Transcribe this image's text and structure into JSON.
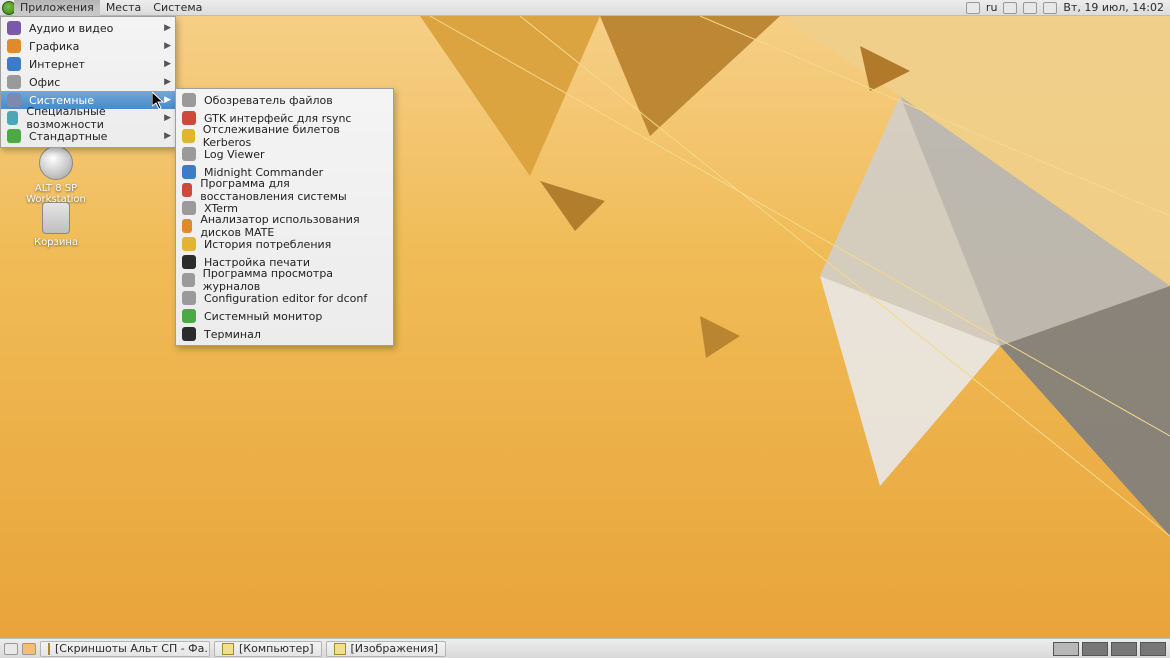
{
  "panel": {
    "menus": {
      "applications": "Приложения",
      "places": "Места",
      "system": "Система"
    },
    "tray": {
      "kb_layout": "ru",
      "clock": "Вт, 19 июл, 14:02"
    }
  },
  "desktop": {
    "icon1_line1": "ALT 8 SP",
    "icon1_line2": "Workstation",
    "trash_label": "Корзина"
  },
  "app_menu": {
    "items": [
      {
        "label": "Аудио и видео",
        "has_sub": true
      },
      {
        "label": "Графика",
        "has_sub": true
      },
      {
        "label": "Интернет",
        "has_sub": true
      },
      {
        "label": "Офис",
        "has_sub": true
      },
      {
        "label": "Системные",
        "has_sub": true,
        "selected": true
      },
      {
        "label": "Специальные возможности",
        "has_sub": true
      },
      {
        "label": "Стандартные",
        "has_sub": true
      }
    ]
  },
  "sub_menu": {
    "items": [
      {
        "label": "Обозреватель файлов"
      },
      {
        "label": "GTK интерфейс для rsync"
      },
      {
        "label": "Отслеживание билетов Kerberos"
      },
      {
        "label": "Log Viewer"
      },
      {
        "label": "Midnight Commander"
      },
      {
        "label": "Программа для восстановления системы"
      },
      {
        "label": "XTerm"
      },
      {
        "label": "Анализатор использования дисков MATE"
      },
      {
        "label": "История потребления"
      },
      {
        "label": "Настройка печати"
      },
      {
        "label": "Программа просмотра журналов"
      },
      {
        "label": "Configuration editor for dconf"
      },
      {
        "label": "Системный монитор"
      },
      {
        "label": "Терминал"
      }
    ]
  },
  "taskbar": {
    "tasks": [
      {
        "label": "[Скриншоты Альт СП - Фа..."
      },
      {
        "label": "[Компьютер]"
      },
      {
        "label": "[Изображения]"
      }
    ]
  }
}
